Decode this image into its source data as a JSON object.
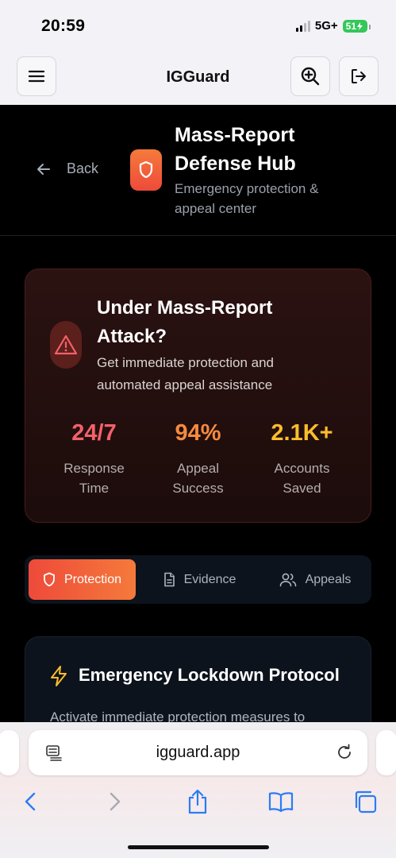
{
  "status": {
    "time": "20:59",
    "network": "5G+",
    "battery": "51"
  },
  "app": {
    "title": "IGGuard"
  },
  "hero": {
    "back_label": "Back",
    "title_line1": "Mass-Report",
    "title_line2": "Defense Hub",
    "subtitle_line1": "Emergency protection &",
    "subtitle_line2": "appeal center"
  },
  "alert": {
    "title_line1": "Under Mass-Report",
    "title_line2": "Attack?",
    "sub_line1": "Get immediate protection and",
    "sub_line2": "automated appeal assistance",
    "stats": [
      {
        "value": "24/7",
        "label_line1": "Response",
        "label_line2": "Time",
        "color": "#f2616a"
      },
      {
        "value": "94%",
        "label_line1": "Appeal",
        "label_line2": "Success",
        "color": "#f58a3f"
      },
      {
        "value": "2.1K+",
        "label_line1": "Accounts",
        "label_line2": "Saved",
        "color": "#fbbd2c"
      }
    ]
  },
  "tabs": [
    {
      "label": "Protection",
      "icon": "shield-icon",
      "active": true
    },
    {
      "label": "Evidence",
      "icon": "document-icon",
      "active": false
    },
    {
      "label": "Appeals",
      "icon": "users-icon",
      "active": false
    }
  ],
  "lockdown": {
    "title": "Emergency Lockdown Protocol",
    "desc": "Activate immediate protection measures to"
  },
  "browser": {
    "url": "igguard.app"
  },
  "colors": {
    "accent_start": "#ee4a3a",
    "accent_end": "#f57a3b",
    "bolt": "#fbbd2c"
  }
}
